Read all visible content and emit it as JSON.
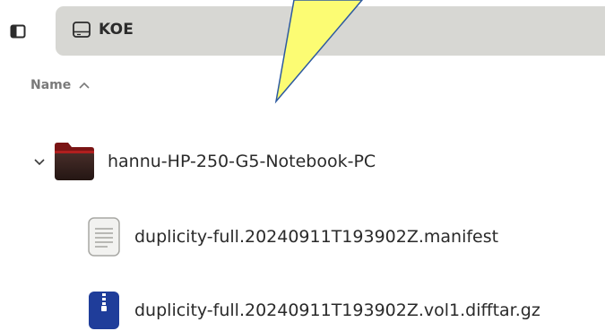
{
  "sidebar_toggle": {
    "icon": "sidebar-toggle-icon"
  },
  "pathbar": {
    "location": {
      "icon": "drive-icon",
      "label": "KOE"
    }
  },
  "columns": {
    "name": {
      "label": "Name",
      "sort": "ascending",
      "icon": "chevron-up-icon"
    }
  },
  "files": [
    {
      "name": "hannu-HP-250-G5-Notebook-PC",
      "type": "folder",
      "expanded": true,
      "icon": "folder-icon"
    },
    {
      "name": "duplicity-full.20240911T193902Z.manifest",
      "type": "text",
      "icon": "text-file-icon"
    },
    {
      "name": "duplicity-full.20240911T193902Z.vol1.difftar.gz",
      "type": "archive",
      "icon": "archive-file-icon"
    }
  ],
  "colors": {
    "pathbar_bg": "#d7d7d3",
    "callout_fill": "#fcfc73",
    "callout_stroke": "#2d5aa0"
  }
}
